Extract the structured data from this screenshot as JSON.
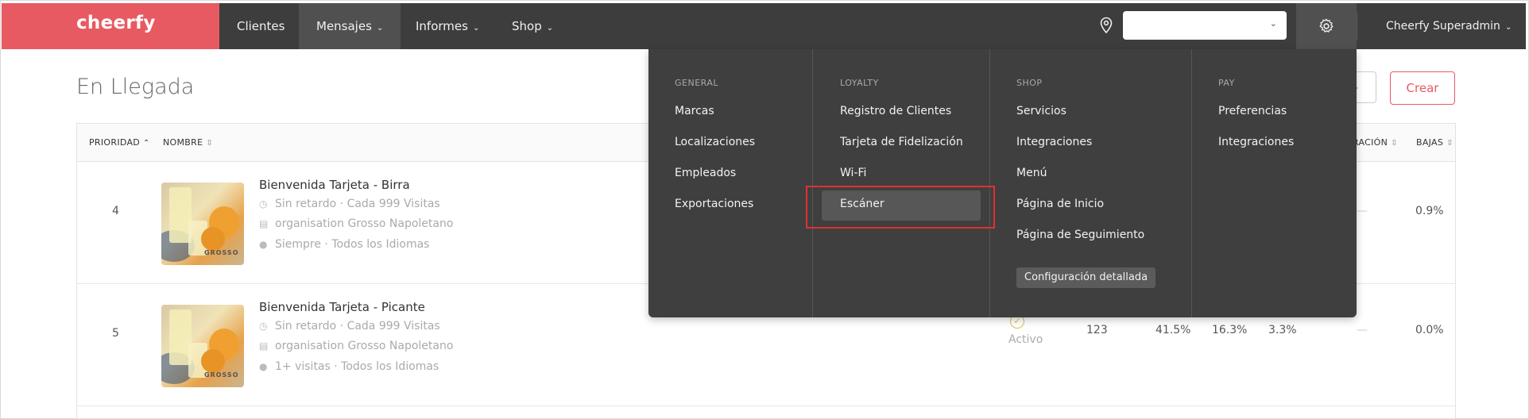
{
  "header": {
    "logo": "cheerfy",
    "nav": [
      {
        "label": "Clientes"
      },
      {
        "label": "Mensajes"
      },
      {
        "label": "Informes"
      },
      {
        "label": "Shop"
      }
    ],
    "location_select_value": "",
    "user": "Cheerfy Superadmin"
  },
  "page": {
    "title": "En Llegada",
    "create_button": "Crear"
  },
  "table": {
    "headers": {
      "prioridad": "PRIORIDAD",
      "nombre": "NOMBRE",
      "duracion": "RACIÓN",
      "bajas": "BAJAS"
    },
    "rows": [
      {
        "priority": "4",
        "title": "Bienvenida Tarjeta - Birra",
        "delay": "Sin retardo",
        "frequency": "Cada 999 Visitas",
        "org": "organisation Grosso Napoletano",
        "audience": "Siempre",
        "language": "Todos los Idiomas",
        "duration": "—",
        "bajas": "0.9%"
      },
      {
        "priority": "5",
        "title": "Bienvenida Tarjeta - Picante",
        "delay": "Sin retardo",
        "frequency": "Cada 999 Visitas",
        "org": "organisation Grosso Napoletano",
        "audience": "1+ visitas",
        "language": "Todos los Idiomas",
        "status": "Activo",
        "count": "123",
        "pct1": "41.5%",
        "pct2": "16.3%",
        "pct3": "3.3%",
        "duration": "—",
        "bajas": "0.0%"
      }
    ],
    "image_brand": "GROSSO"
  },
  "menu": {
    "general": {
      "heading": "GENERAL",
      "items": [
        "Marcas",
        "Localizaciones",
        "Empleados",
        "Exportaciones"
      ]
    },
    "loyalty": {
      "heading": "LOYALTY",
      "items": [
        "Registro de Clientes",
        "Tarjeta de Fidelización",
        "Wi-Fi",
        "Escáner"
      ]
    },
    "shop": {
      "heading": "SHOP",
      "items": [
        "Servicios",
        "Integraciones",
        "Menú",
        "Página de Inicio",
        "Página de Seguimiento"
      ],
      "chip": "Configuración detallada"
    },
    "pay": {
      "heading": "PAY",
      "items": [
        "Preferencias",
        "Integraciones"
      ]
    }
  },
  "colors": {
    "brand": "#e85a62",
    "topbar": "#3d3d3d",
    "menu": "#3f3f3f",
    "highlight_box": "#e03030"
  },
  "icons": [
    "location-pin-icon",
    "gear-icon",
    "clock-icon",
    "store-icon",
    "user-icon",
    "chevron-down-icon",
    "sort-icon",
    "check-circle-icon"
  ]
}
